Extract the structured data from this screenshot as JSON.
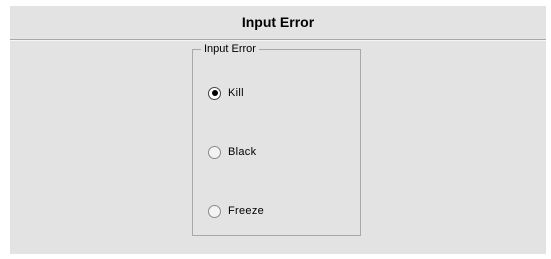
{
  "dialog": {
    "title": "Input Error"
  },
  "group": {
    "legend": "Input Error",
    "options": [
      {
        "label": "Kill",
        "selected": true
      },
      {
        "label": "Black",
        "selected": false
      },
      {
        "label": "Freeze",
        "selected": false
      }
    ]
  }
}
